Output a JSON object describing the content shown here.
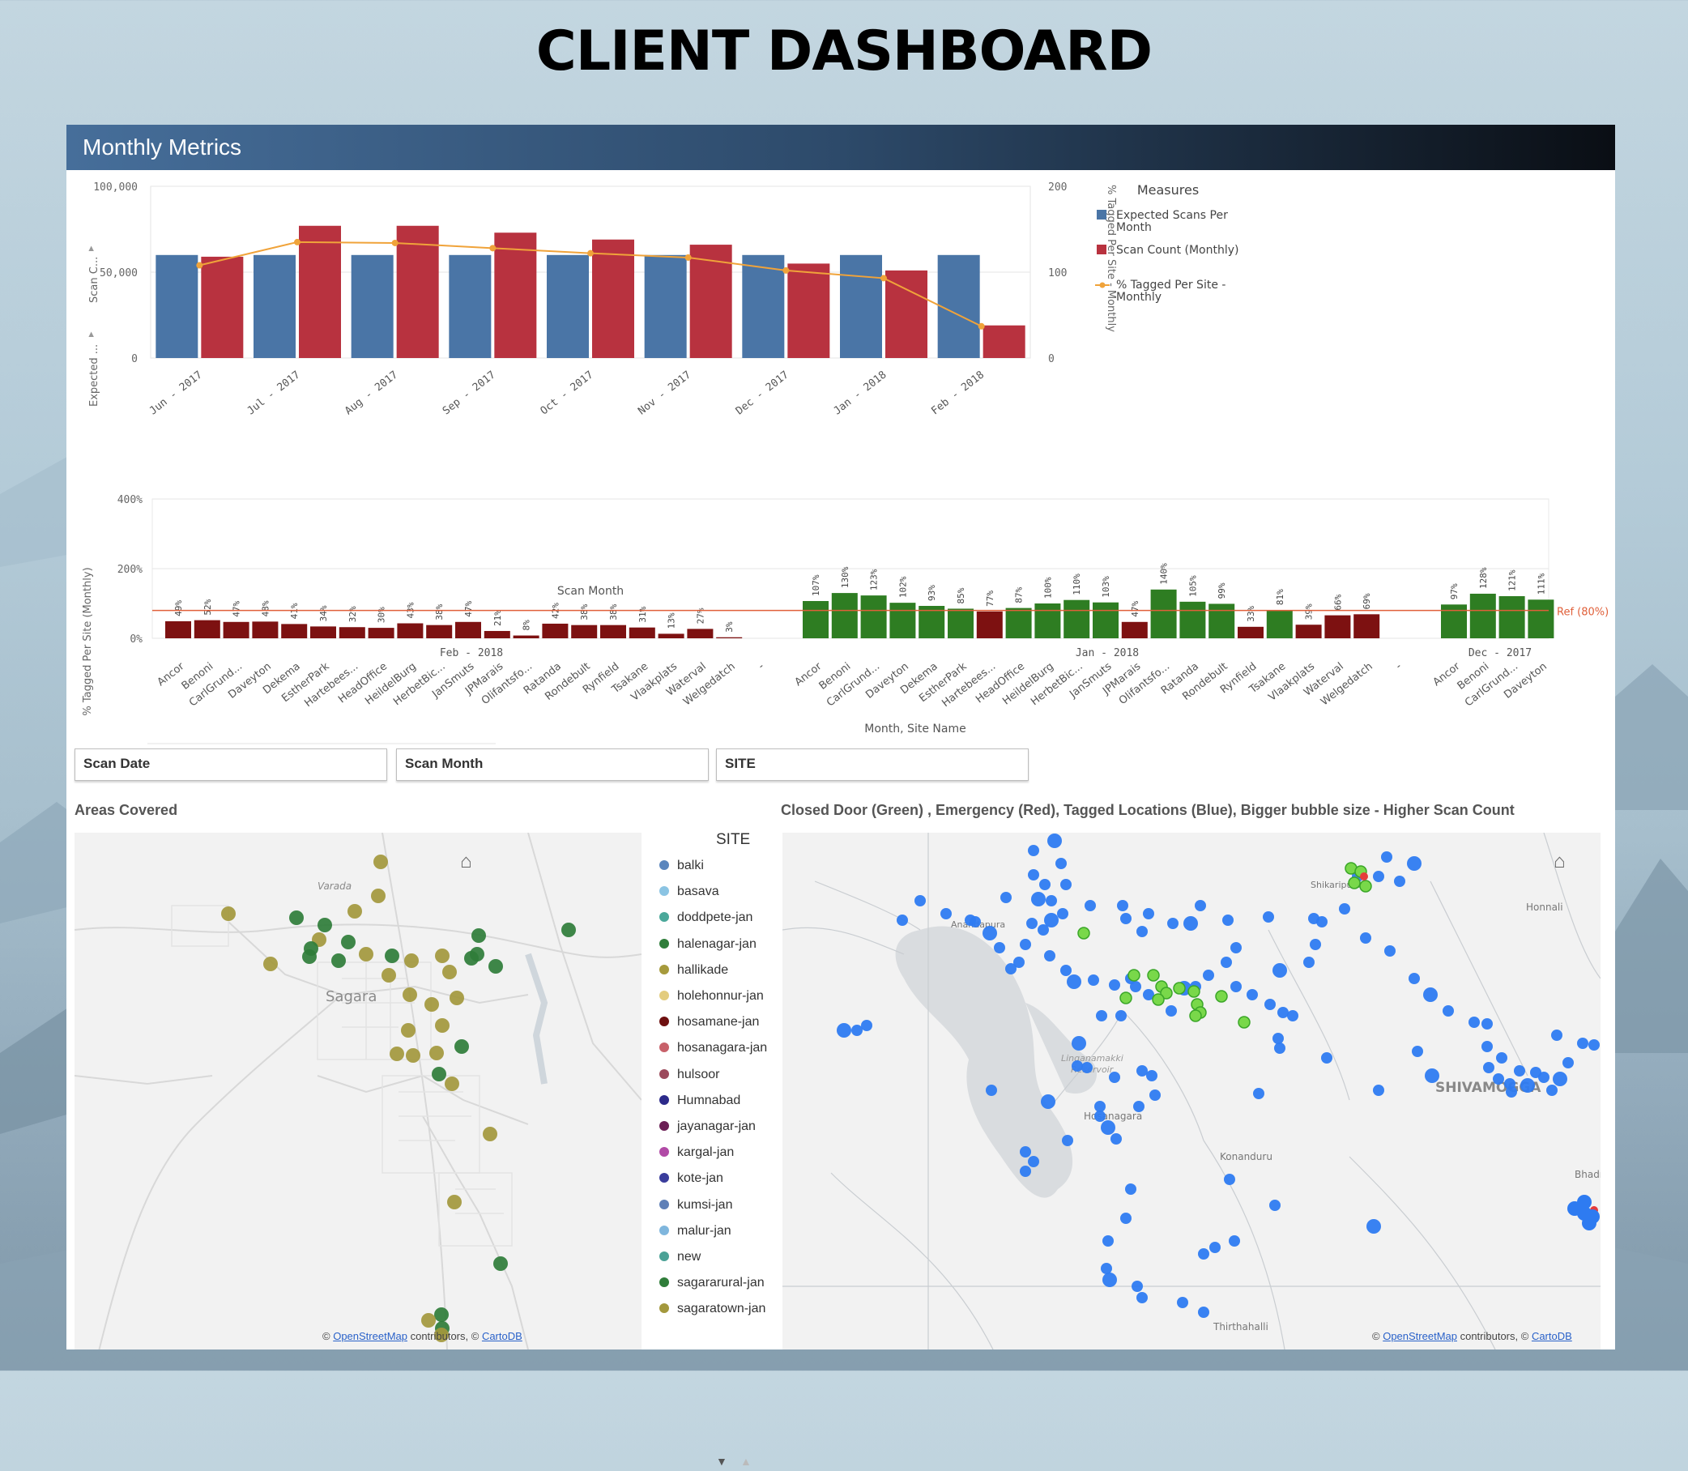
{
  "page": {
    "title": "CLIENT DASHBOARD"
  },
  "panel": {
    "title": "Monthly Metrics"
  },
  "combo": {
    "y_left_ticks": [
      "100,000",
      "50,000",
      "0"
    ],
    "y_right_ticks": [
      "200",
      "100",
      "0"
    ],
    "y_left_title_a": "Expected ...",
    "y_left_title_b": "Scan C...",
    "y_right_title": "% Tagged Per Site - Monthly",
    "xlabel": "Scan Month",
    "legend_title": "Measures",
    "legend": [
      {
        "line1": "Expected Scans Per",
        "line2": "Month",
        "color": "#4a75a6"
      },
      {
        "line1": "Scan Count (Monthly)",
        "line2": "",
        "color": "#b8323f"
      },
      {
        "line1": "% Tagged Per Site -",
        "line2": "Monthly",
        "color": "#f0a33a"
      }
    ]
  },
  "tagged": {
    "y_ticks": [
      "400%",
      "200%",
      "0%"
    ],
    "ylabel": "% Tagged Per Site (Monthly)",
    "xlabel": "Month, Site Name",
    "ref_label": "Ref (80%)",
    "groups": [
      "Feb - 2018",
      "Jan - 2018",
      "Dec - 2017"
    ]
  },
  "filters": [
    {
      "label": "Scan Date"
    },
    {
      "label": "Scan Month"
    },
    {
      "label": "SITE"
    }
  ],
  "maps": {
    "left_title": "Areas Covered",
    "right_title": "Closed Door (Green) , Emergency (Red), Tagged Locations (Blue), Bigger bubble size - Higher Scan Count",
    "attribution_link1": "OpenStreetMap",
    "attribution_mid": " contributors, © ",
    "attribution_link2": "CartoDB",
    "attribution_prefix": "© ",
    "left_labels": {
      "town": "Sagara",
      "varada": "Varada"
    },
    "right_labels": {
      "honnali": "Honnali",
      "linganamakki": "Linganamakki",
      "reservoir": "Reservoir",
      "hosanagara": "Hosanagara",
      "konanduru": "Konanduru",
      "shivamogga": "SHIVAMOGGA",
      "bhadravati": "Bhadravati",
      "thirthahalli": "Thirthahalli",
      "shikaripura": "Shikaripura",
      "anandapura": "Anandapura"
    }
  },
  "site_legend": {
    "title": "SITE",
    "items": [
      {
        "label": "balki",
        "color": "#5b86bd"
      },
      {
        "label": "basava",
        "color": "#8bc4e3"
      },
      {
        "label": "doddpete-jan",
        "color": "#4aa89a"
      },
      {
        "label": "halenagar-jan",
        "color": "#2f7d3a"
      },
      {
        "label": "hallikade",
        "color": "#a69a3c"
      },
      {
        "label": "holehonnur-jan",
        "color": "#e3cc7e"
      },
      {
        "label": "hosamane-jan",
        "color": "#6e1010"
      },
      {
        "label": "hosanagara-jan",
        "color": "#c8616a"
      },
      {
        "label": "hulsoor",
        "color": "#9c4a5c"
      },
      {
        "label": "Humnabad",
        "color": "#2c2a8a"
      },
      {
        "label": "jayanagar-jan",
        "color": "#6b1f55"
      },
      {
        "label": "kargal-jan",
        "color": "#b14aa6"
      },
      {
        "label": "kote-jan",
        "color": "#3a3d9c"
      },
      {
        "label": "kumsi-jan",
        "color": "#5f80b7"
      },
      {
        "label": "malur-jan",
        "color": "#7fb6dd"
      },
      {
        "label": "new",
        "color": "#4ba296"
      },
      {
        "label": "sagararural-jan",
        "color": "#2f7d3a"
      },
      {
        "label": "sagaratown-jan",
        "color": "#a3983d"
      }
    ]
  },
  "chart_data": [
    {
      "type": "bar",
      "title": "",
      "xlabel": "Scan Month",
      "ylabel": "Expected ... Scan C...",
      "categories": [
        "Jun - 2017",
        "Jul - 2017",
        "Aug - 2017",
        "Sep - 2017",
        "Oct - 2017",
        "Nov - 2017",
        "Dec - 2017",
        "Jan - 2018",
        "Feb - 2018"
      ],
      "ylim": [
        0,
        100000
      ],
      "y2lim": [
        0,
        200
      ],
      "series": [
        {
          "name": "Expected Scans Per Month",
          "type": "bar",
          "color": "#4a75a6",
          "values": [
            60000,
            60000,
            60000,
            60000,
            60000,
            60000,
            60000,
            60000,
            60000
          ]
        },
        {
          "name": "Scan Count (Monthly)",
          "type": "bar",
          "color": "#b8323f",
          "values": [
            59000,
            77000,
            77000,
            73000,
            69000,
            66000,
            55000,
            51000,
            19000
          ]
        },
        {
          "name": "% Tagged Per Site - Monthly",
          "type": "line",
          "axis": "right",
          "color": "#f0a33a",
          "values": [
            108,
            135,
            134,
            128,
            122,
            117,
            102,
            93,
            37
          ]
        }
      ],
      "grid": true,
      "legend": "right"
    },
    {
      "type": "bar",
      "title": "",
      "xlabel": "Month, Site Name",
      "ylabel": "% Tagged Per Site (Monthly)",
      "ylim": [
        0,
        400
      ],
      "reference_line": {
        "label": "Ref (80%)",
        "value": 80
      },
      "groups": [
        {
          "name": "Feb - 2018",
          "sites": [
            "Ancor",
            "Benoni",
            "CarlGrund...",
            "Daveyton",
            "Dekema",
            "EstherPark",
            "Hartebees...",
            "HeadOffice",
            "HeildelBurg",
            "HerbetBic...",
            "JanSmuts",
            "JPMarais",
            "Olifantsfo...",
            "Ratanda",
            "Rondebult",
            "Rynfield",
            "Tsakane",
            "Vlaakplats",
            "Waterval",
            "Welgedatch",
            "-"
          ],
          "values": [
            49,
            52,
            47,
            48,
            41,
            34,
            32,
            30,
            43,
            38,
            47,
            21,
            8,
            42,
            38,
            38,
            31,
            13,
            27,
            3,
            null
          ]
        },
        {
          "name": "Jan - 2018",
          "sites": [
            "Ancor",
            "Benoni",
            "CarlGrund...",
            "Daveyton",
            "Dekema",
            "EstherPark",
            "Hartebees...",
            "HeadOffice",
            "HeildelBurg",
            "HerbetBic...",
            "JanSmuts",
            "JPMarais",
            "Olifantsfo...",
            "Ratanda",
            "Rondebult",
            "Rynfield",
            "Tsakane",
            "Vlaakplats",
            "Waterval",
            "Welgedatch",
            "-"
          ],
          "values": [
            107,
            130,
            123,
            102,
            93,
            85,
            77,
            87,
            100,
            110,
            103,
            47,
            140,
            105,
            99,
            33,
            81,
            39,
            66,
            69,
            null
          ]
        },
        {
          "name": "Dec - 2017",
          "sites": [
            "Ancor",
            "Benoni",
            "CarlGrund...",
            "Daveyton"
          ],
          "values": [
            97,
            128,
            121,
            111
          ]
        }
      ],
      "colors": {
        "above_ref": "#2e7d22",
        "below_ref": "#7d1111"
      },
      "grid": true
    }
  ]
}
